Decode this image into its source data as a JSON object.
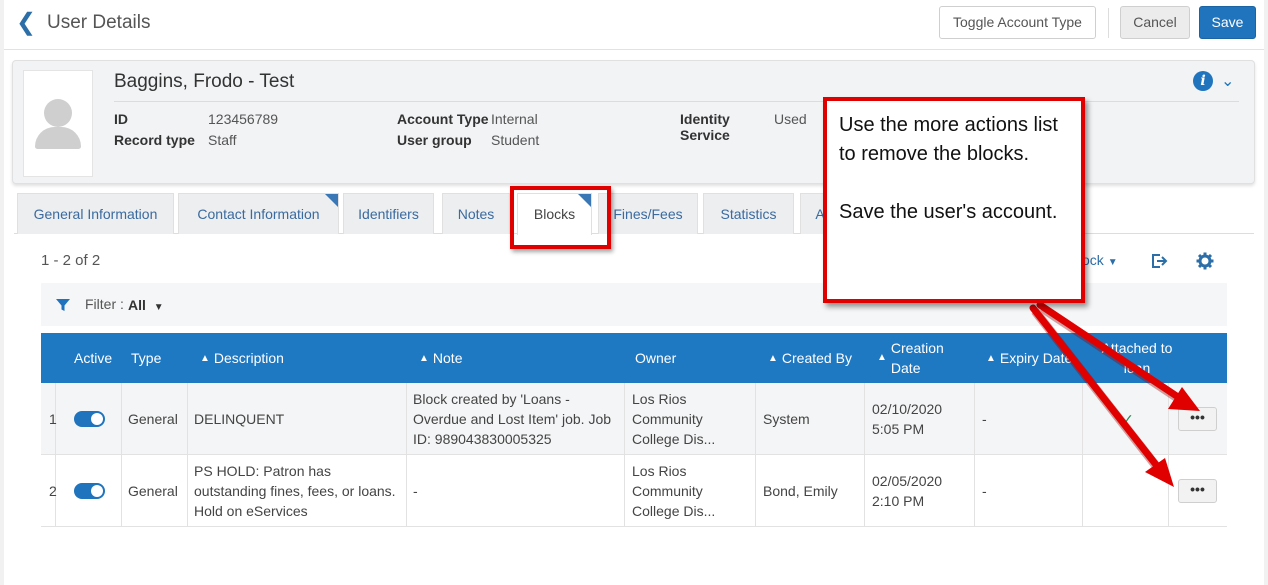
{
  "header": {
    "back_icon": "chevron-left-icon",
    "title": "User Details",
    "toggle_label": "Toggle Account Type",
    "cancel_label": "Cancel",
    "save_label": "Save"
  },
  "user": {
    "name": "Baggins, Frodo - Test",
    "fields": [
      {
        "key": "ID",
        "value": "123456789"
      },
      {
        "key": "Record type",
        "value": "Staff"
      },
      {
        "key": "Account Type",
        "value": "Internal"
      },
      {
        "key": "User group",
        "value": "Student"
      },
      {
        "key": "Identity Service",
        "value": "Used"
      }
    ]
  },
  "tabs": [
    {
      "label": "General Information"
    },
    {
      "label": "Contact Information"
    },
    {
      "label": "Identifiers"
    },
    {
      "label": "Notes"
    },
    {
      "label": "Blocks"
    },
    {
      "label": "Fines/Fees"
    },
    {
      "label": "Statistics"
    },
    {
      "label": "A"
    }
  ],
  "toolbar": {
    "count": "1 - 2 of 2",
    "block_menu": "ock",
    "filter_label": "Filter :",
    "filter_value": "All"
  },
  "table": {
    "headers": [
      "Active",
      "Type",
      "Description",
      "Note",
      "Owner",
      "Created By",
      "Creation",
      "Date",
      "Expiry Date",
      "Attached to",
      "loan"
    ],
    "rows": [
      {
        "index": "1",
        "type": "General",
        "description": "DELINQUENT",
        "note": "Block created by 'Loans - Overdue and Lost Item' job. Job ID: 989043830005325",
        "owner": "Los Rios Community College Dis...",
        "created_by": "System",
        "creation_date": "02/10/2020",
        "creation_time": "5:05 PM",
        "expiry": "-",
        "attached": "✓",
        "more": "•••"
      },
      {
        "index": "2",
        "type": "General",
        "description": "PS HOLD: Patron has outstanding fines, fees, or loans. Hold on eServices",
        "note": "-",
        "owner": "Los Rios Community College Dis...",
        "created_by": "Bond, Emily",
        "creation_date": "02/05/2020",
        "creation_time": "2:10 PM",
        "expiry": "-",
        "attached": "",
        "more": "•••"
      }
    ]
  },
  "callout": {
    "line1": "Use the more actions list to remove the blocks.",
    "line2": "Save the user's account."
  },
  "colors": {
    "accent": "#1f74bd",
    "header_bg": "#1f78c2",
    "annotation_red": "#e00000"
  }
}
